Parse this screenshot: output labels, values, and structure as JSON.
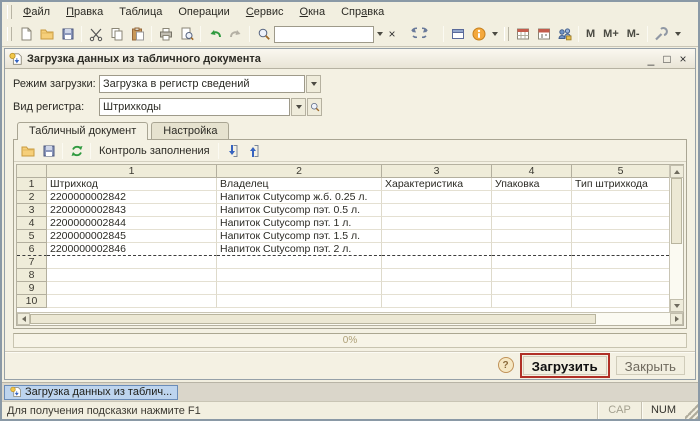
{
  "menu": {
    "items": [
      {
        "pre": "",
        "key": "Ф",
        "post": "айл"
      },
      {
        "pre": "",
        "key": "П",
        "post": "равка"
      },
      {
        "pre": "Таблица",
        "key": "",
        "post": ""
      },
      {
        "pre": "Операции",
        "key": "",
        "post": ""
      },
      {
        "pre": "",
        "key": "С",
        "post": "ервис"
      },
      {
        "pre": "",
        "key": "О",
        "post": "кна"
      },
      {
        "pre": "Спр",
        "key": "а",
        "post": "вка"
      }
    ]
  },
  "toolbar": {
    "search_value": "",
    "memory": [
      "M",
      "M+",
      "M-"
    ],
    "clear_glyph": "×"
  },
  "dialog": {
    "title": "Загрузка данных из табличного документа",
    "controls": {
      "minimize": "_",
      "maximize": "□",
      "close": "×"
    },
    "load_mode_label": "Режим загрузки:",
    "load_mode_value": "Загрузка в регистр сведений",
    "register_label": "Вид регистра:",
    "register_value": "Штрихкоды",
    "tabs": [
      {
        "label": "Табличный документ"
      },
      {
        "label": "Настройка"
      }
    ],
    "tab_toolbar": {
      "control_label": "Контроль заполнения"
    },
    "progress_value": "0%",
    "buttons": {
      "help": "?",
      "load": "Загрузить",
      "close": "Закрыть"
    }
  },
  "table": {
    "col_headers": [
      "1",
      "2",
      "3",
      "4",
      "5"
    ],
    "field_row_num": "1",
    "field_names": [
      "Штрихкод",
      "Владелец",
      "Характеристика",
      "Упаковка",
      "Тип штрихкода"
    ],
    "rows": [
      {
        "num": "2",
        "barcode": "2200000002842",
        "owner": "Напиток Cutycomp ж.б. 0.25 л."
      },
      {
        "num": "3",
        "barcode": "2200000002843",
        "owner": "Напиток Cutycomp пэт. 0.5 л."
      },
      {
        "num": "4",
        "barcode": "2200000002844",
        "owner": "Напиток Cutycomp пэт. 1 л."
      },
      {
        "num": "5",
        "barcode": "2200000002845",
        "owner": "Напиток Cutycomp пэт. 1.5 л."
      },
      {
        "num": "6",
        "barcode": "2200000002846",
        "owner": "Напиток Cutycomp пэт. 2 л."
      }
    ],
    "empty_row_nums": [
      "7",
      "8",
      "9",
      "10"
    ]
  },
  "taskbar": {
    "item_label": "Загрузка данных из таблич..."
  },
  "statusbar": {
    "hint": "Для получения подсказки нажмите F1",
    "cap": "CAP",
    "num": "NUM"
  },
  "colors": {
    "annotation_red": "#b03026",
    "taskitem_blue": "#bdd4ee",
    "chrome_cream": "#f2efe0"
  }
}
